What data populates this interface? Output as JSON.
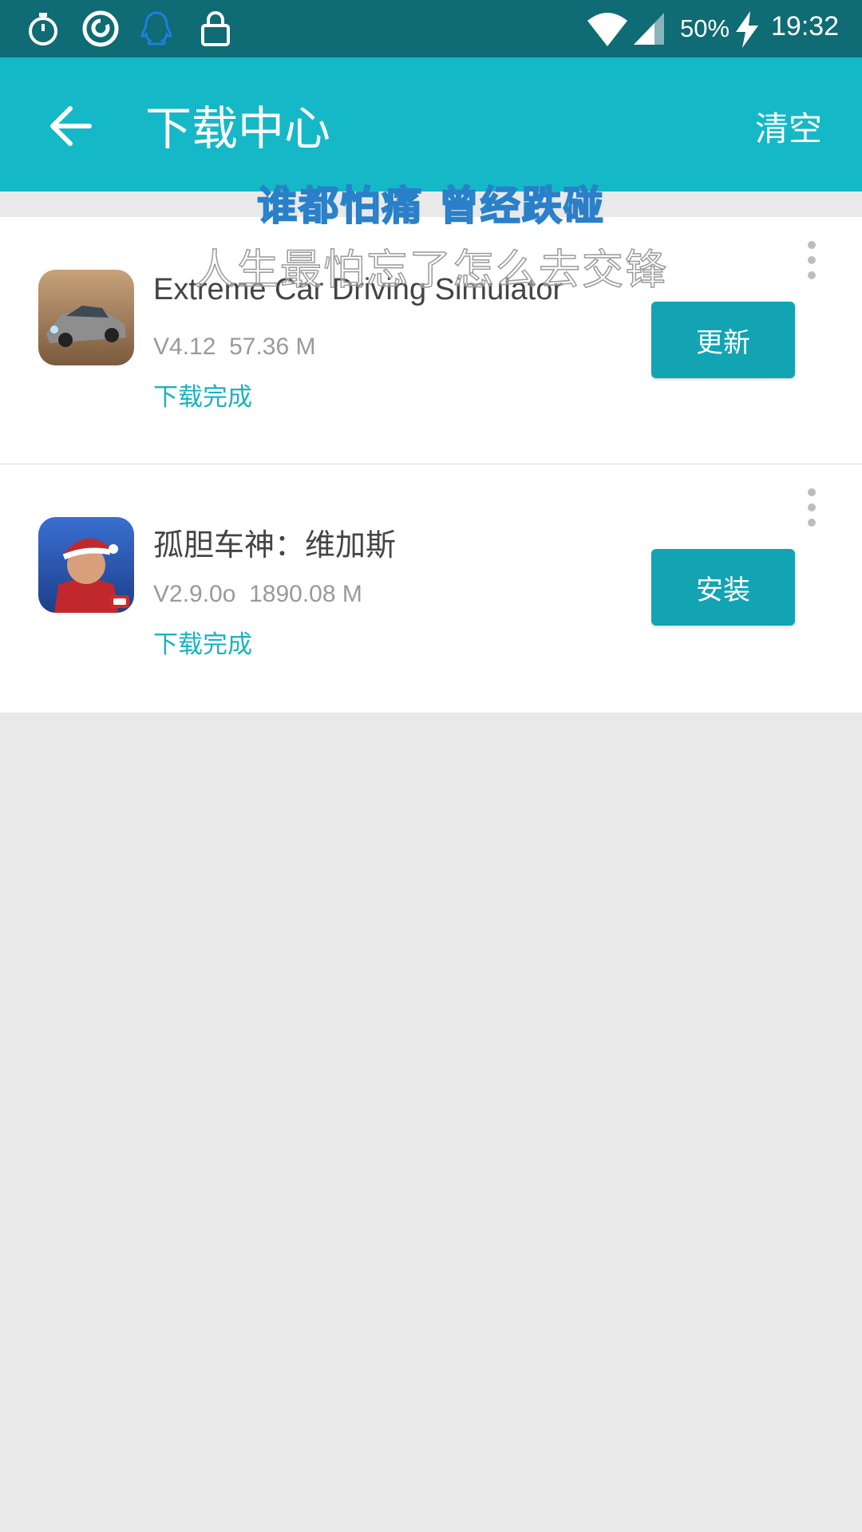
{
  "status_bar": {
    "battery": "50%",
    "time": "19:32",
    "icons": [
      "stopwatch-icon",
      "netease-music-icon",
      "qq-icon",
      "lock-icon",
      "wifi-icon",
      "signal-icon",
      "charging-icon"
    ]
  },
  "app_bar": {
    "title": "下载中心",
    "clear_label": "清空"
  },
  "downloads": [
    {
      "name": "Extreme Car Driving Simulator",
      "version": "V4.12",
      "size": "57.36 M",
      "status": "下载完成",
      "action": "更新",
      "icon": "car-game-icon"
    },
    {
      "name": "孤胆车神：维加斯",
      "version": "V2.9.0o",
      "size": "1890.08 M",
      "status": "下载完成",
      "action": "安装",
      "icon": "gangstar-game-icon"
    }
  ],
  "lyrics_overlay": {
    "line1": "谁都怕痛 曾经跌碰",
    "line2": "人生最怕忘了怎么去交锋"
  },
  "colors": {
    "status_bar": "#0f6b74",
    "app_bar": "#15b8c6",
    "button": "#12a4b2",
    "status_text": "#19b3c0",
    "background": "#e9e9e9"
  }
}
